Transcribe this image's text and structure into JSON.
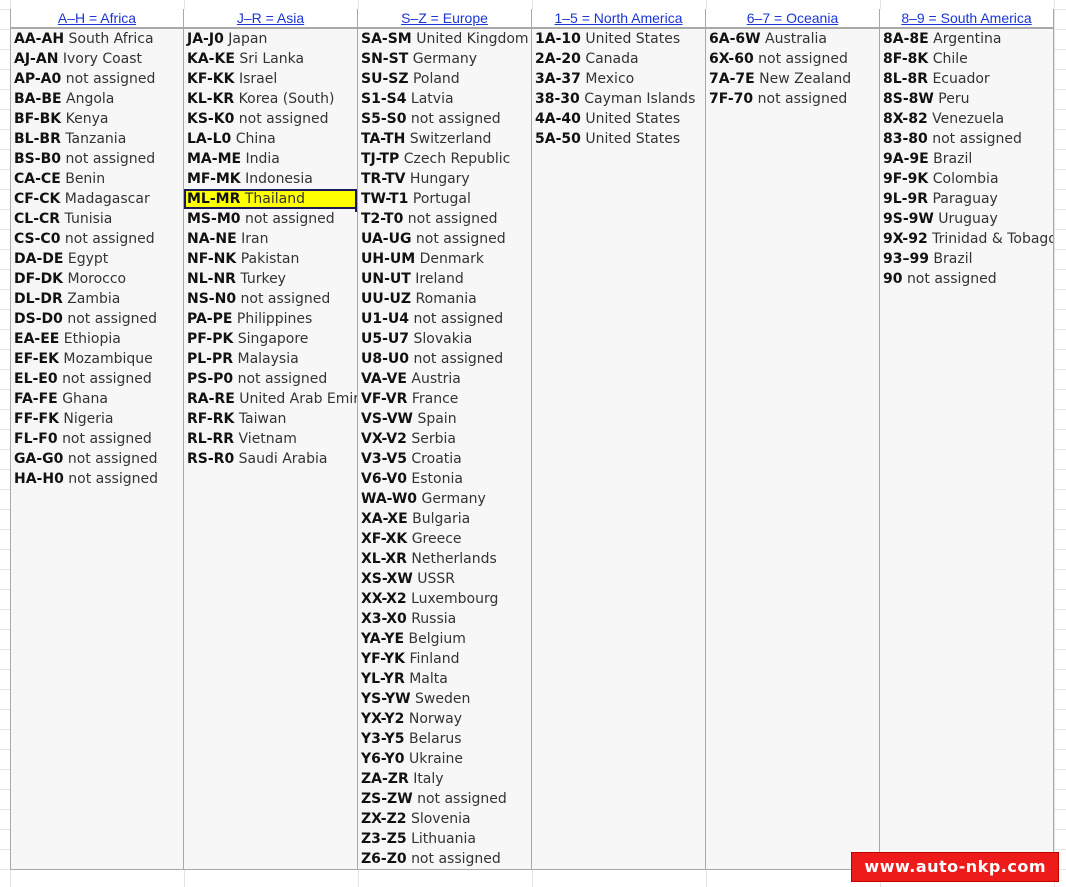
{
  "sheet": {
    "columns": [
      {
        "header": "A–H = Africa",
        "rows": [
          {
            "code": "AA-AH",
            "country": "South Africa"
          },
          {
            "code": "AJ-AN",
            "country": "Ivory Coast"
          },
          {
            "code": "AP-A0",
            "country": "not assigned"
          },
          {
            "code": "BA-BE",
            "country": "Angola"
          },
          {
            "code": "BF-BK",
            "country": "Kenya"
          },
          {
            "code": "BL-BR",
            "country": "Tanzania"
          },
          {
            "code": "BS-B0",
            "country": "not assigned"
          },
          {
            "code": "CA-CE",
            "country": "Benin"
          },
          {
            "code": "CF-CK",
            "country": "Madagascar"
          },
          {
            "code": "CL-CR",
            "country": "Tunisia"
          },
          {
            "code": "CS-C0",
            "country": "not assigned"
          },
          {
            "code": "DA-DE",
            "country": "Egypt"
          },
          {
            "code": "DF-DK",
            "country": "Morocco"
          },
          {
            "code": "DL-DR",
            "country": "Zambia"
          },
          {
            "code": "DS-D0",
            "country": "not assigned"
          },
          {
            "code": "EA-EE",
            "country": "Ethiopia"
          },
          {
            "code": "EF-EK",
            "country": "Mozambique"
          },
          {
            "code": "EL-E0",
            "country": "not assigned"
          },
          {
            "code": "FA-FE",
            "country": "Ghana"
          },
          {
            "code": "FF-FK",
            "country": "Nigeria"
          },
          {
            "code": "FL-F0",
            "country": "not assigned"
          },
          {
            "code": "GA-G0",
            "country": "not assigned"
          },
          {
            "code": "HA-H0",
            "country": "not assigned"
          }
        ]
      },
      {
        "header": "J–R = Asia",
        "rows": [
          {
            "code": "JA-J0",
            "country": "Japan"
          },
          {
            "code": "KA-KE",
            "country": "Sri Lanka"
          },
          {
            "code": "KF-KK",
            "country": "Israel"
          },
          {
            "code": "KL-KR",
            "country": "Korea (South)"
          },
          {
            "code": "KS-K0",
            "country": "not assigned"
          },
          {
            "code": "LA-L0",
            "country": "China"
          },
          {
            "code": "MA-ME",
            "country": "India"
          },
          {
            "code": "MF-MK",
            "country": "Indonesia"
          },
          {
            "code": "ML-MR",
            "country": "Thailand",
            "selected": true
          },
          {
            "code": "MS-M0",
            "country": "not assigned"
          },
          {
            "code": "NA-NE",
            "country": "Iran"
          },
          {
            "code": "NF-NK",
            "country": "Pakistan"
          },
          {
            "code": "NL-NR",
            "country": "Turkey"
          },
          {
            "code": "NS-N0",
            "country": "not assigned"
          },
          {
            "code": "PA-PE",
            "country": "Philippines"
          },
          {
            "code": "PF-PK",
            "country": "Singapore"
          },
          {
            "code": "PL-PR",
            "country": "Malaysia"
          },
          {
            "code": "PS-P0",
            "country": "not assigned"
          },
          {
            "code": "RA-RE",
            "country": "United Arab Emirat"
          },
          {
            "code": "RF-RK",
            "country": "Taiwan"
          },
          {
            "code": "RL-RR",
            "country": "Vietnam"
          },
          {
            "code": "RS-R0",
            "country": "Saudi Arabia"
          }
        ]
      },
      {
        "header": "S–Z = Europe",
        "rows": [
          {
            "code": "SA-SM",
            "country": "United Kingdom"
          },
          {
            "code": "SN-ST",
            "country": "Germany"
          },
          {
            "code": "SU-SZ",
            "country": "Poland"
          },
          {
            "code": "S1-S4",
            "country": "Latvia"
          },
          {
            "code": "S5-S0",
            "country": "not assigned"
          },
          {
            "code": "TA-TH",
            "country": "Switzerland"
          },
          {
            "code": "TJ-TP",
            "country": "Czech Republic"
          },
          {
            "code": "TR-TV",
            "country": "Hungary"
          },
          {
            "code": "TW-T1",
            "country": "Portugal"
          },
          {
            "code": "T2-T0",
            "country": "not assigned"
          },
          {
            "code": "UA-UG",
            "country": "not assigned"
          },
          {
            "code": "UH-UM",
            "country": "Denmark"
          },
          {
            "code": "UN-UT",
            "country": "Ireland"
          },
          {
            "code": "UU-UZ",
            "country": "Romania"
          },
          {
            "code": "U1-U4",
            "country": "not assigned"
          },
          {
            "code": "U5-U7",
            "country": "Slovakia"
          },
          {
            "code": "U8-U0",
            "country": "not assigned"
          },
          {
            "code": "VA-VE",
            "country": "Austria"
          },
          {
            "code": "VF-VR",
            "country": "France"
          },
          {
            "code": "VS-VW",
            "country": "Spain"
          },
          {
            "code": "VX-V2",
            "country": "Serbia"
          },
          {
            "code": "V3-V5",
            "country": "Croatia"
          },
          {
            "code": "V6-V0",
            "country": "Estonia"
          },
          {
            "code": "WA-W0",
            "country": "Germany"
          },
          {
            "code": "XA-XE",
            "country": "Bulgaria"
          },
          {
            "code": "XF-XK",
            "country": "Greece"
          },
          {
            "code": "XL-XR",
            "country": "Netherlands"
          },
          {
            "code": "XS-XW",
            "country": "USSR"
          },
          {
            "code": "XX-X2",
            "country": "Luxembourg"
          },
          {
            "code": "X3-X0",
            "country": "Russia"
          },
          {
            "code": "YA-YE",
            "country": "Belgium"
          },
          {
            "code": "YF-YK",
            "country": "Finland"
          },
          {
            "code": "YL-YR",
            "country": "Malta"
          },
          {
            "code": "YS-YW",
            "country": "Sweden"
          },
          {
            "code": "YX-Y2",
            "country": "Norway"
          },
          {
            "code": "Y3-Y5",
            "country": "Belarus"
          },
          {
            "code": "Y6-Y0",
            "country": "Ukraine"
          },
          {
            "code": "ZA-ZR",
            "country": "Italy"
          },
          {
            "code": "ZS-ZW",
            "country": "not assigned"
          },
          {
            "code": "ZX-Z2",
            "country": "Slovenia"
          },
          {
            "code": "Z3-Z5",
            "country": "Lithuania"
          },
          {
            "code": "Z6-Z0",
            "country": "not assigned"
          }
        ]
      },
      {
        "header": "1–5 = North America",
        "rows": [
          {
            "code": "1A-10",
            "country": "United States"
          },
          {
            "code": "2A-20",
            "country": "Canada"
          },
          {
            "code": "3A-37",
            "country": "Mexico"
          },
          {
            "code": "38-30",
            "country": "Cayman Islands"
          },
          {
            "code": "4A-40",
            "country": "United States"
          },
          {
            "code": "5A-50",
            "country": "United States"
          }
        ]
      },
      {
        "header": "6–7 = Oceania",
        "rows": [
          {
            "code": "6A-6W",
            "country": "Australia"
          },
          {
            "code": "6X-60",
            "country": "not assigned"
          },
          {
            "code": "7A-7E",
            "country": "New Zealand"
          },
          {
            "code": "7F-70",
            "country": "not assigned"
          }
        ]
      },
      {
        "header": "8–9 = South America",
        "rows": [
          {
            "code": "8A-8E",
            "country": "Argentina"
          },
          {
            "code": "8F-8K",
            "country": "Chile"
          },
          {
            "code": "8L-8R",
            "country": "Ecuador"
          },
          {
            "code": "8S-8W",
            "country": "Peru"
          },
          {
            "code": "8X-82",
            "country": "Venezuela"
          },
          {
            "code": "83-80",
            "country": "not assigned"
          },
          {
            "code": "9A-9E",
            "country": "Brazil"
          },
          {
            "code": "9F-9K",
            "country": "Colombia"
          },
          {
            "code": "9L-9R",
            "country": "Paraguay"
          },
          {
            "code": "9S-9W",
            "country": "Uruguay"
          },
          {
            "code": "9X-92",
            "country": "Trinidad & Tobago"
          },
          {
            "code": "93–99",
            "country": "Brazil"
          },
          {
            "code": "90",
            "country": "not assigned"
          }
        ]
      }
    ]
  },
  "watermark": {
    "text": "www.auto-nkp.com"
  },
  "colors": {
    "header_link": "#1a36d8",
    "selection_fill": "#ffff00",
    "watermark_bg": "#ee1b1b"
  }
}
